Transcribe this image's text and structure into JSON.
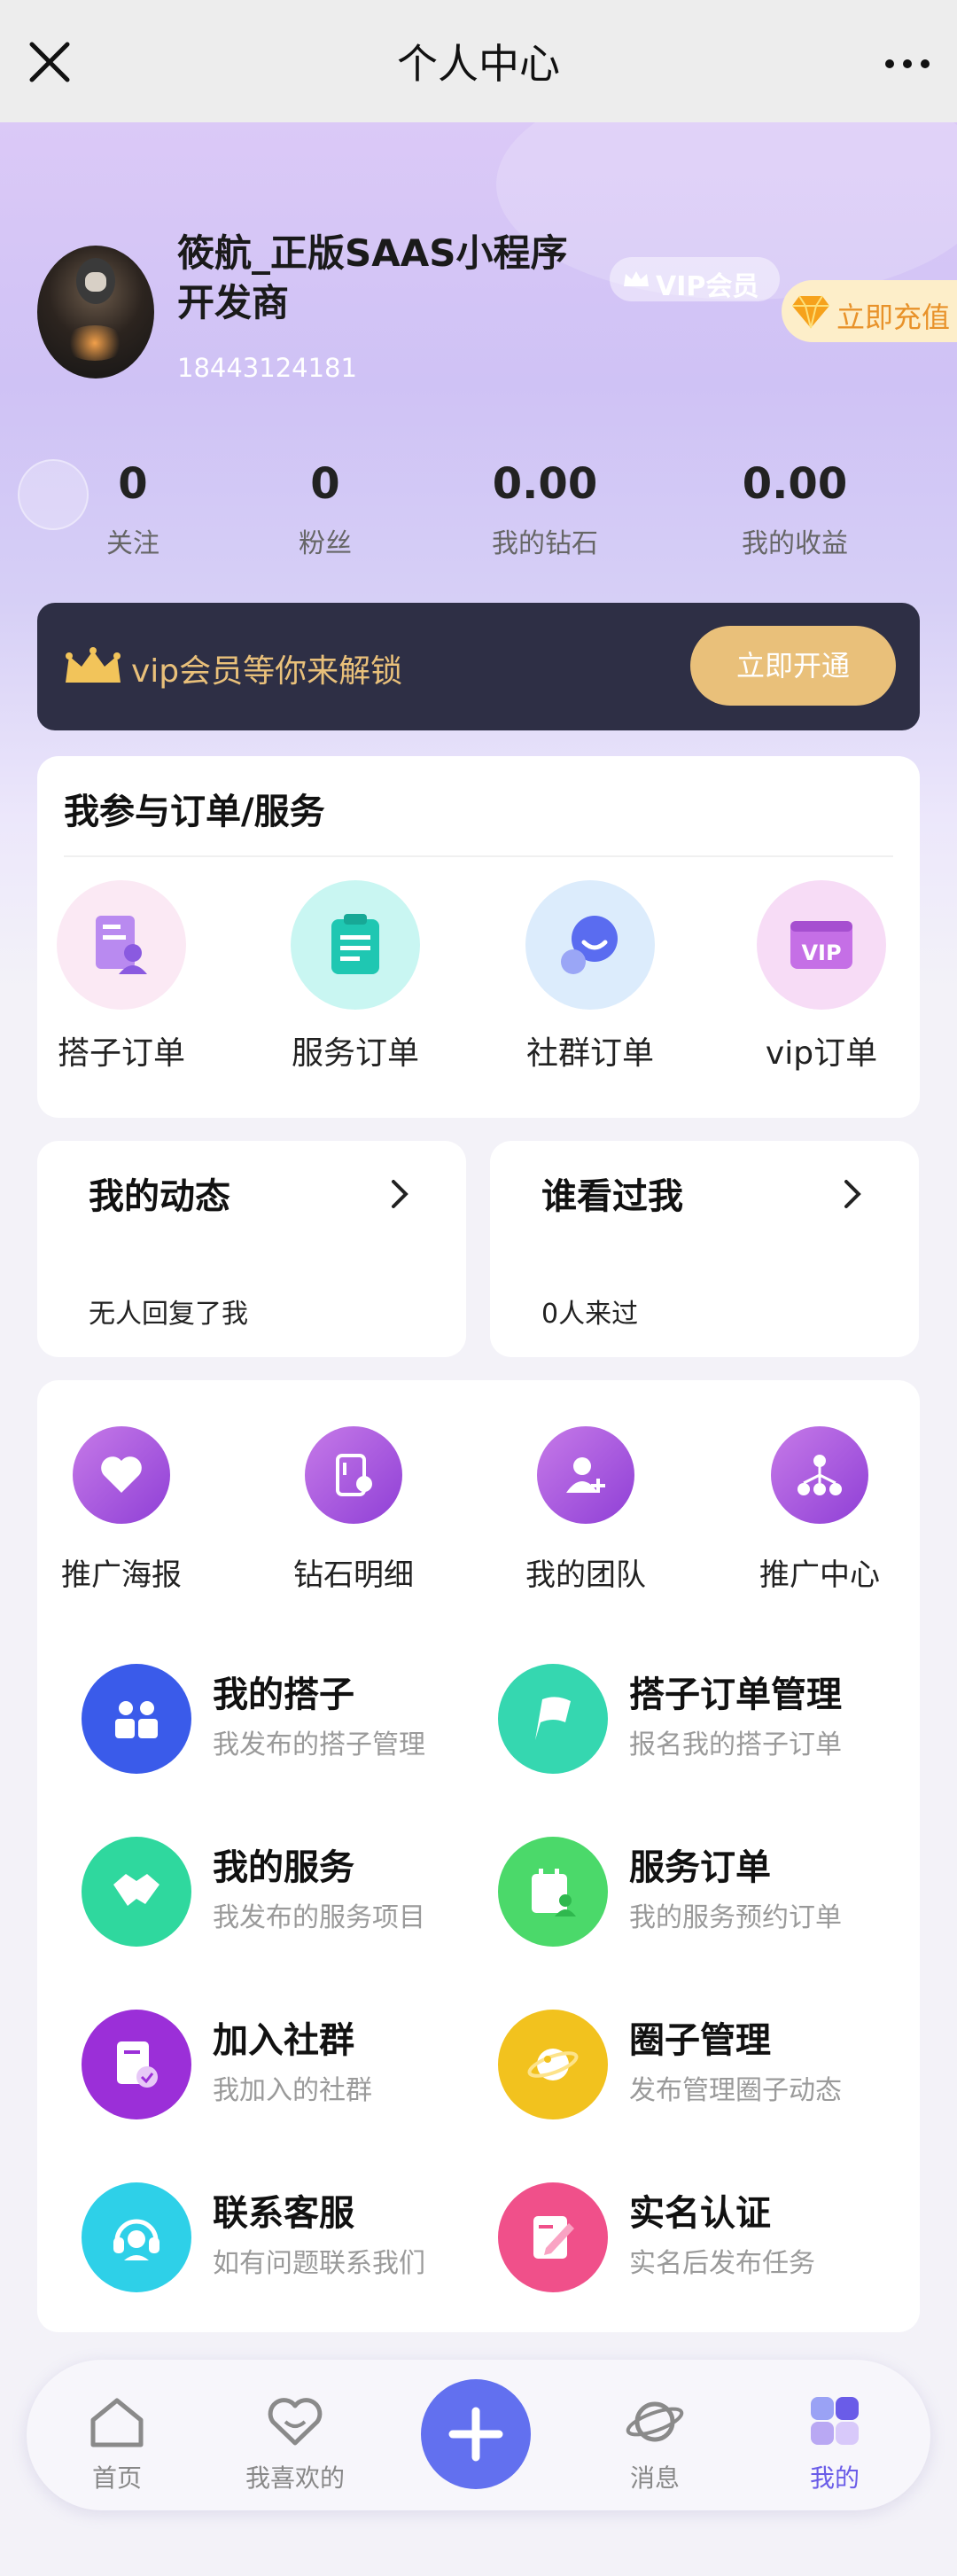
{
  "navbar": {
    "title": "个人中心"
  },
  "profile": {
    "name": "筱航_正版SAAS小程序开发商",
    "phone": "18443124181",
    "vip_badge": "VIP会员",
    "recharge": "立即充值"
  },
  "stats": [
    {
      "value": "0",
      "label": "关注"
    },
    {
      "value": "0",
      "label": "粉丝"
    },
    {
      "value": "0.00",
      "label": "我的钻石"
    },
    {
      "value": "0.00",
      "label": "我的收益"
    }
  ],
  "vip_banner": {
    "text": "vip会员等你来解锁",
    "button": "立即开通"
  },
  "orders": {
    "title": "我参与订单/服务",
    "items": [
      {
        "label": "搭子订单",
        "icon": "document-user-icon"
      },
      {
        "label": "服务订单",
        "icon": "clipboard-icon"
      },
      {
        "label": "社群订单",
        "icon": "chat-bubble-icon"
      },
      {
        "label": "vip订单",
        "icon": "vip-card-icon"
      }
    ]
  },
  "activity": {
    "left": {
      "title": "我的动态",
      "sub": "无人回复了我"
    },
    "right": {
      "title": "谁看过我",
      "sub": "0人来过"
    }
  },
  "tools": [
    {
      "label": "推广海报",
      "icon": "heart-icon"
    },
    {
      "label": "钻石明细",
      "icon": "wallet-icon"
    },
    {
      "label": "我的团队",
      "icon": "add-user-icon"
    },
    {
      "label": "推广中心",
      "icon": "network-icon"
    }
  ],
  "features": [
    {
      "title": "我的搭子",
      "sub": "我发布的搭子管理",
      "icon": "people-icon",
      "color": "#3a5bea"
    },
    {
      "title": "搭子订单管理",
      "sub": "报名我的搭子订单",
      "icon": "flag-icon",
      "color": "#35d7b0"
    },
    {
      "title": "我的服务",
      "sub": "我发布的服务项目",
      "icon": "handshake-icon",
      "color": "#2fd89e"
    },
    {
      "title": "服务订单",
      "sub": "我的服务预约订单",
      "icon": "calendar-user-icon",
      "color": "#4bd96a"
    },
    {
      "title": "加入社群",
      "sub": "我加入的社群",
      "icon": "document-check-icon",
      "color": "#9b2fd8"
    },
    {
      "title": "圈子管理",
      "sub": "发布管理圈子动态",
      "icon": "planet-icon",
      "color": "#f2c21e"
    },
    {
      "title": "联系客服",
      "sub": "如有问题联系我们",
      "icon": "headset-icon",
      "color": "#2ed0e8"
    },
    {
      "title": "实名认证",
      "sub": "实名后发布任务",
      "icon": "edit-document-icon",
      "color": "#f0508a"
    }
  ],
  "tabbar": [
    {
      "label": "首页",
      "icon": "home-icon"
    },
    {
      "label": "我喜欢的",
      "icon": "heart-outline-icon"
    },
    {
      "label": "消息",
      "icon": "planet-outline-icon"
    },
    {
      "label": "我的",
      "icon": "profile-icon",
      "active": true
    }
  ]
}
